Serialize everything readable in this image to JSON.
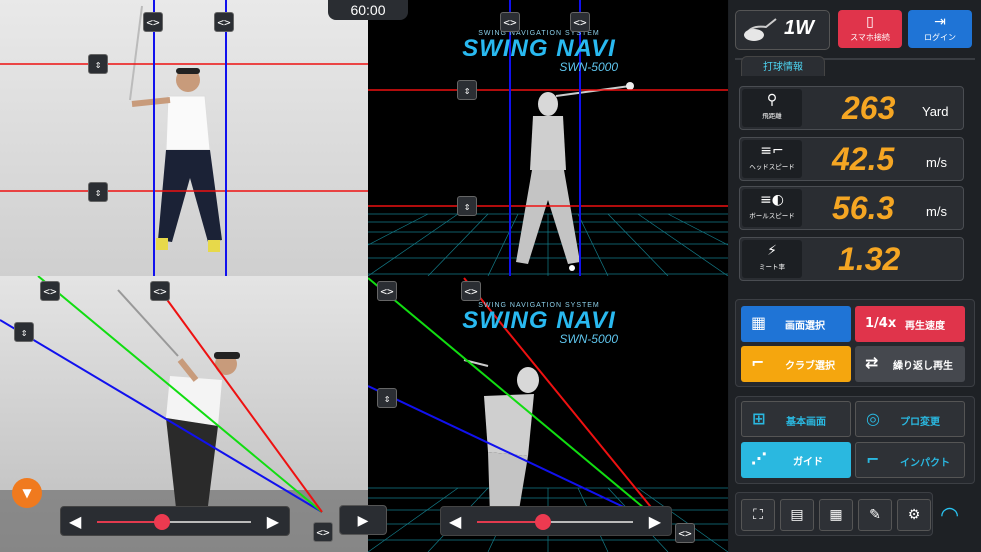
{
  "timer": "60:00",
  "logo": {
    "subtitle": "SWING NAVIGATION SYSTEM",
    "name": "SWING NAVI",
    "model": "SWN-5000"
  },
  "club": {
    "label": "1W",
    "icon": "driver-club-icon"
  },
  "header_buttons": [
    {
      "label": "スマホ接続",
      "icon": "smartphone-icon",
      "color": "#e0344b"
    },
    {
      "label": "ログイン",
      "icon": "login-icon",
      "color": "#1f74d6"
    }
  ],
  "tab": "打球情報",
  "stats": [
    {
      "label": "飛距離",
      "value": "263",
      "unit": "Yard",
      "icon": "ball-distance-icon"
    },
    {
      "label": "ヘッドスピード",
      "value": "42.5",
      "unit": "m/s",
      "icon": "head-speed-icon"
    },
    {
      "label": "ボールスピード",
      "value": "56.3",
      "unit": "m/s",
      "icon": "ball-speed-icon"
    },
    {
      "label": "ミート率",
      "value": "1.32",
      "unit": "",
      "icon": "meet-rate-icon"
    }
  ],
  "controls": {
    "screen_select": "画面選択",
    "speed_value": "1/4x",
    "speed_label": "再生速度",
    "club_select": "クラブ選択",
    "repeat_play": "繰り返し再生",
    "basic_screen": "基本画面",
    "pro_change": "プロ変更",
    "guide": "ガイド",
    "impact": "インパクト"
  },
  "colors": {
    "accent": "#2ab8e0",
    "value": "#f5a623",
    "red": "#e0344b",
    "blue": "#1f74d6",
    "orange": "#f5a60e"
  },
  "playback": {
    "left_position": 0.42,
    "right_position": 0.42
  }
}
